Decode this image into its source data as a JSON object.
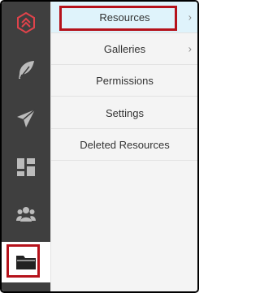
{
  "sidebar": {
    "items": [
      {
        "icon": "logo-icon"
      },
      {
        "icon": "feather-icon"
      },
      {
        "icon": "paper-plane-icon"
      },
      {
        "icon": "dashboard-icon"
      },
      {
        "icon": "users-icon"
      },
      {
        "icon": "folder-icon",
        "active": true
      }
    ]
  },
  "menu": {
    "items": [
      {
        "label": "Resources",
        "has_arrow": true,
        "selected": true
      },
      {
        "label": "Galleries",
        "has_arrow": true
      },
      {
        "label": "Permissions"
      },
      {
        "label": "Settings"
      },
      {
        "label": "Deleted Resources"
      }
    ],
    "arrow_glyph": "›"
  },
  "colors": {
    "sidebar_bg": "#3f3f3f",
    "brand_red": "#e0434b",
    "highlight_box": "#b5121b",
    "selected_bg": "#dff3fb"
  }
}
